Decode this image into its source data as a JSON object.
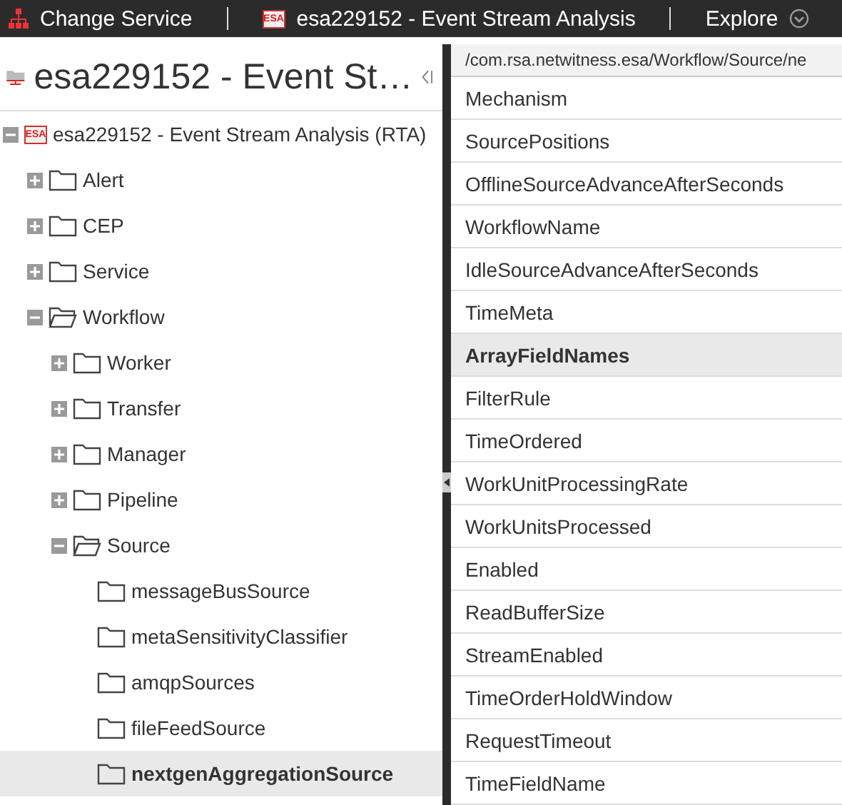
{
  "top_bar": {
    "change_service": "Change Service",
    "service": {
      "badge": "ESA",
      "title": "esa229152 - Event Stream Analysis"
    },
    "menu": "Explore"
  },
  "left_panel": {
    "title": "esa229152 - Event St…",
    "tree": [
      {
        "kind": "service",
        "badge": "ESA",
        "label": "esa229152 - Event Stream Analysis (RTA)",
        "expanded": true,
        "selected": false,
        "children": [
          {
            "kind": "folder",
            "label": "Alert",
            "expanded": false,
            "selected": false
          },
          {
            "kind": "folder",
            "label": "CEP",
            "expanded": false,
            "selected": false
          },
          {
            "kind": "folder",
            "label": "Service",
            "expanded": false,
            "selected": false
          },
          {
            "kind": "folder",
            "label": "Workflow",
            "expanded": true,
            "selected": false,
            "children": [
              {
                "kind": "folder",
                "label": "Worker",
                "expanded": false,
                "selected": false
              },
              {
                "kind": "folder",
                "label": "Transfer",
                "expanded": false,
                "selected": false
              },
              {
                "kind": "folder",
                "label": "Manager",
                "expanded": false,
                "selected": false
              },
              {
                "kind": "folder",
                "label": "Pipeline",
                "expanded": false,
                "selected": false
              },
              {
                "kind": "folder",
                "label": "Source",
                "expanded": true,
                "selected": false,
                "children": [
                  {
                    "kind": "leaf",
                    "label": "messageBusSource",
                    "selected": false
                  },
                  {
                    "kind": "leaf",
                    "label": "metaSensitivityClassifier",
                    "selected": false
                  },
                  {
                    "kind": "leaf",
                    "label": "amqpSources",
                    "selected": false
                  },
                  {
                    "kind": "leaf",
                    "label": "fileFeedSource",
                    "selected": false
                  },
                  {
                    "kind": "leaf",
                    "label": "nextgenAggregationSource",
                    "selected": true
                  }
                ]
              }
            ]
          }
        ]
      }
    ]
  },
  "right_panel": {
    "path": "/com.rsa.netwitness.esa/Workflow/Source/ne",
    "rows": [
      {
        "name": "Mechanism",
        "selected": false
      },
      {
        "name": "SourcePositions",
        "selected": false
      },
      {
        "name": "OfflineSourceAdvanceAfterSeconds",
        "selected": false
      },
      {
        "name": "WorkflowName",
        "selected": false
      },
      {
        "name": "IdleSourceAdvanceAfterSeconds",
        "selected": false
      },
      {
        "name": "TimeMeta",
        "selected": false
      },
      {
        "name": "ArrayFieldNames",
        "selected": true
      },
      {
        "name": "FilterRule",
        "selected": false
      },
      {
        "name": "TimeOrdered",
        "selected": false
      },
      {
        "name": "WorkUnitProcessingRate",
        "selected": false
      },
      {
        "name": "WorkUnitsProcessed",
        "selected": false
      },
      {
        "name": "Enabled",
        "selected": false
      },
      {
        "name": "ReadBufferSize",
        "selected": false
      },
      {
        "name": "StreamEnabled",
        "selected": false
      },
      {
        "name": "TimeOrderHoldWindow",
        "selected": false
      },
      {
        "name": "RequestTimeout",
        "selected": false
      },
      {
        "name": "TimeFieldName",
        "selected": false
      }
    ]
  }
}
